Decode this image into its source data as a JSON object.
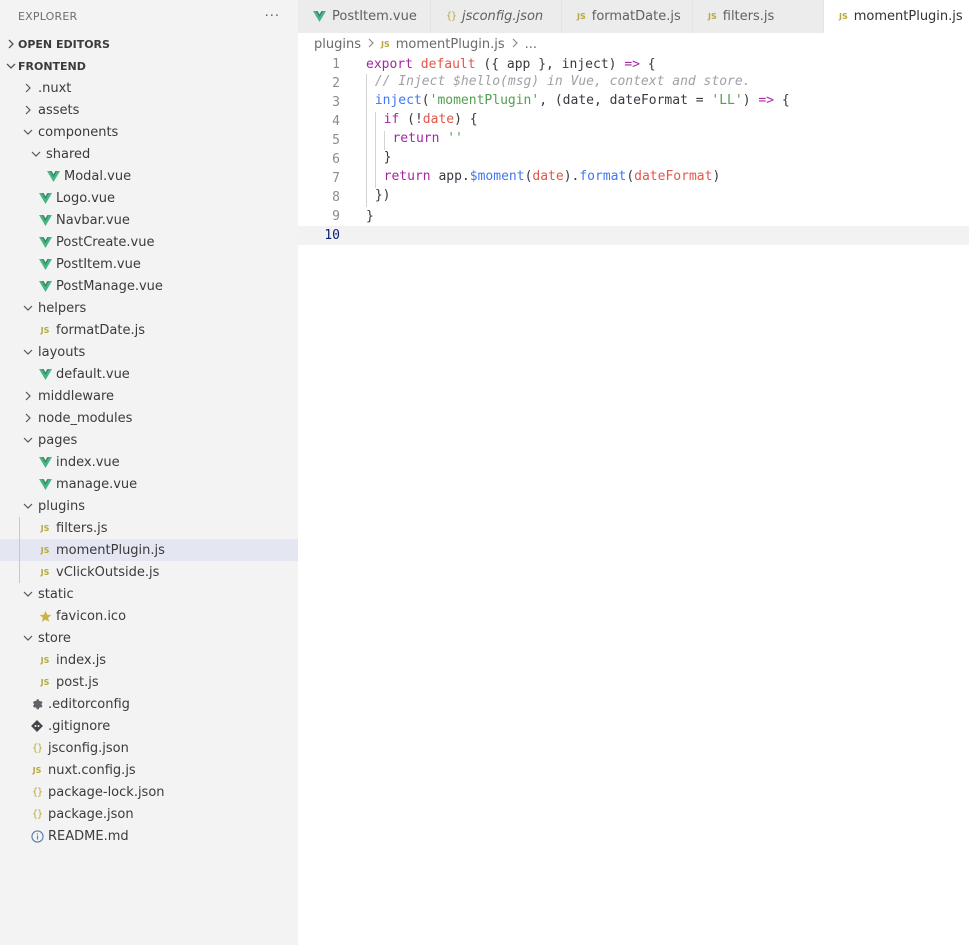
{
  "explorer": {
    "title": "EXPLORER",
    "more": "···",
    "open_editors": "OPEN EDITORS",
    "workspace": "FRONTEND"
  },
  "tree": [
    {
      "label": ".nuxt",
      "type": "folder",
      "open": false,
      "depth": 1
    },
    {
      "label": "assets",
      "type": "folder",
      "open": false,
      "depth": 1
    },
    {
      "label": "components",
      "type": "folder",
      "open": true,
      "depth": 1
    },
    {
      "label": "shared",
      "type": "folder",
      "open": true,
      "depth": 2
    },
    {
      "label": "Modal.vue",
      "type": "vue",
      "depth": 3
    },
    {
      "label": "Logo.vue",
      "type": "vue",
      "depth": 2
    },
    {
      "label": "Navbar.vue",
      "type": "vue",
      "depth": 2
    },
    {
      "label": "PostCreate.vue",
      "type": "vue",
      "depth": 2
    },
    {
      "label": "PostItem.vue",
      "type": "vue",
      "depth": 2
    },
    {
      "label": "PostManage.vue",
      "type": "vue",
      "depth": 2
    },
    {
      "label": "helpers",
      "type": "folder",
      "open": true,
      "depth": 1
    },
    {
      "label": "formatDate.js",
      "type": "js",
      "depth": 2
    },
    {
      "label": "layouts",
      "type": "folder",
      "open": true,
      "depth": 1
    },
    {
      "label": "default.vue",
      "type": "vue",
      "depth": 2
    },
    {
      "label": "middleware",
      "type": "folder",
      "open": false,
      "depth": 1
    },
    {
      "label": "node_modules",
      "type": "folder",
      "open": false,
      "depth": 1
    },
    {
      "label": "pages",
      "type": "folder",
      "open": true,
      "depth": 1
    },
    {
      "label": "index.vue",
      "type": "vue",
      "depth": 2
    },
    {
      "label": "manage.vue",
      "type": "vue",
      "depth": 2
    },
    {
      "label": "plugins",
      "type": "folder",
      "open": true,
      "depth": 1
    },
    {
      "label": "filters.js",
      "type": "js",
      "depth": 2,
      "guide": true
    },
    {
      "label": "momentPlugin.js",
      "type": "js",
      "depth": 2,
      "guide": true,
      "selected": true
    },
    {
      "label": "vClickOutside.js",
      "type": "js",
      "depth": 2,
      "guide": true
    },
    {
      "label": "static",
      "type": "folder",
      "open": true,
      "depth": 1
    },
    {
      "label": "favicon.ico",
      "type": "star",
      "depth": 2
    },
    {
      "label": "store",
      "type": "folder",
      "open": true,
      "depth": 1
    },
    {
      "label": "index.js",
      "type": "js",
      "depth": 2
    },
    {
      "label": "post.js",
      "type": "js",
      "depth": 2
    },
    {
      "label": ".editorconfig",
      "type": "gear",
      "depth": 1
    },
    {
      "label": ".gitignore",
      "type": "git",
      "depth": 1
    },
    {
      "label": "jsconfig.json",
      "type": "json",
      "depth": 1
    },
    {
      "label": "nuxt.config.js",
      "type": "js",
      "depth": 1
    },
    {
      "label": "package-lock.json",
      "type": "json",
      "depth": 1
    },
    {
      "label": "package.json",
      "type": "json",
      "depth": 1
    },
    {
      "label": "README.md",
      "type": "info",
      "depth": 1
    }
  ],
  "tabs": [
    {
      "label": "PostItem.vue",
      "type": "vue",
      "active": false,
      "italic": false
    },
    {
      "label": "jsconfig.json",
      "type": "json",
      "active": false,
      "italic": true
    },
    {
      "label": "formatDate.js",
      "type": "js",
      "active": false,
      "italic": false
    },
    {
      "label": "filters.js",
      "type": "js",
      "active": false,
      "italic": false
    },
    {
      "label": "momentPlugin.js",
      "type": "js",
      "active": true,
      "italic": false
    }
  ],
  "breadcrumb": {
    "folder": "plugins",
    "file": "momentPlugin.js",
    "tail": "..."
  },
  "code_lines": [
    {
      "n": "1",
      "indent": 0,
      "tokens": [
        [
          "kw",
          "export"
        ],
        [
          "",
          " "
        ],
        [
          "kw2",
          "default"
        ],
        [
          "",
          " ({ app }, inject) "
        ],
        [
          "op",
          "=>"
        ],
        [
          "",
          " {"
        ]
      ]
    },
    {
      "n": "2",
      "indent": 1,
      "tokens": [
        [
          "cmt",
          "// Inject $hello(msg) in Vue, context and store."
        ]
      ]
    },
    {
      "n": "3",
      "indent": 1,
      "tokens": [
        [
          "fn",
          "inject"
        ],
        [
          "",
          "("
        ],
        [
          "str",
          "'momentPlugin'"
        ],
        [
          "",
          ", (date, dateFormat = "
        ],
        [
          "str",
          "'LL'"
        ],
        [
          "",
          ") "
        ],
        [
          "op",
          "=>"
        ],
        [
          "",
          " {"
        ]
      ]
    },
    {
      "n": "4",
      "indent": 2,
      "tokens": [
        [
          "kw",
          "if"
        ],
        [
          "",
          " (!"
        ],
        [
          "var",
          "date"
        ],
        [
          "",
          ") {"
        ]
      ]
    },
    {
      "n": "5",
      "indent": 3,
      "tokens": [
        [
          "kw",
          "return"
        ],
        [
          "",
          " "
        ],
        [
          "str",
          "''"
        ]
      ]
    },
    {
      "n": "6",
      "indent": 2,
      "tokens": [
        [
          "",
          "}"
        ]
      ]
    },
    {
      "n": "7",
      "indent": 2,
      "tokens": [
        [
          "kw",
          "return"
        ],
        [
          "",
          " app."
        ],
        [
          "fn",
          "$moment"
        ],
        [
          "",
          "("
        ],
        [
          "var",
          "date"
        ],
        [
          "",
          ")."
        ],
        [
          "fn",
          "format"
        ],
        [
          "",
          "("
        ],
        [
          "var",
          "dateFormat"
        ],
        [
          "",
          ")"
        ]
      ]
    },
    {
      "n": "8",
      "indent": 1,
      "tokens": [
        [
          "",
          "})"
        ]
      ]
    },
    {
      "n": "9",
      "indent": 0,
      "tokens": [
        [
          "",
          "}"
        ]
      ]
    },
    {
      "n": "10",
      "indent": 0,
      "tokens": [],
      "current": true
    }
  ],
  "colors": {
    "vue_green": "#41b883",
    "js_yellow": "#b8a93c",
    "star_yellow": "#cbb542",
    "selection": "#e4e6f1"
  }
}
